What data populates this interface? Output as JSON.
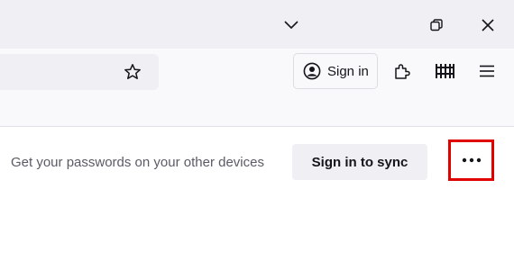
{
  "titlebar": {
    "icons": {
      "tab_list": "chevron-down-icon",
      "restore": "restore-window-icon",
      "close": "close-icon"
    }
  },
  "toolbar": {
    "bookmark_icon": "star-icon",
    "signin_label": "Sign in",
    "account_icon": "account-avatar-icon",
    "extensions_icon": "puzzle-piece-icon",
    "library_icon": "library-icon",
    "menu_icon": "hamburger-menu-icon"
  },
  "promo": {
    "message": "Get your passwords on your other devices",
    "sync_button_label": "Sign in to sync",
    "more_icon": "more-options-icon",
    "highlight_color": "#e00000"
  }
}
